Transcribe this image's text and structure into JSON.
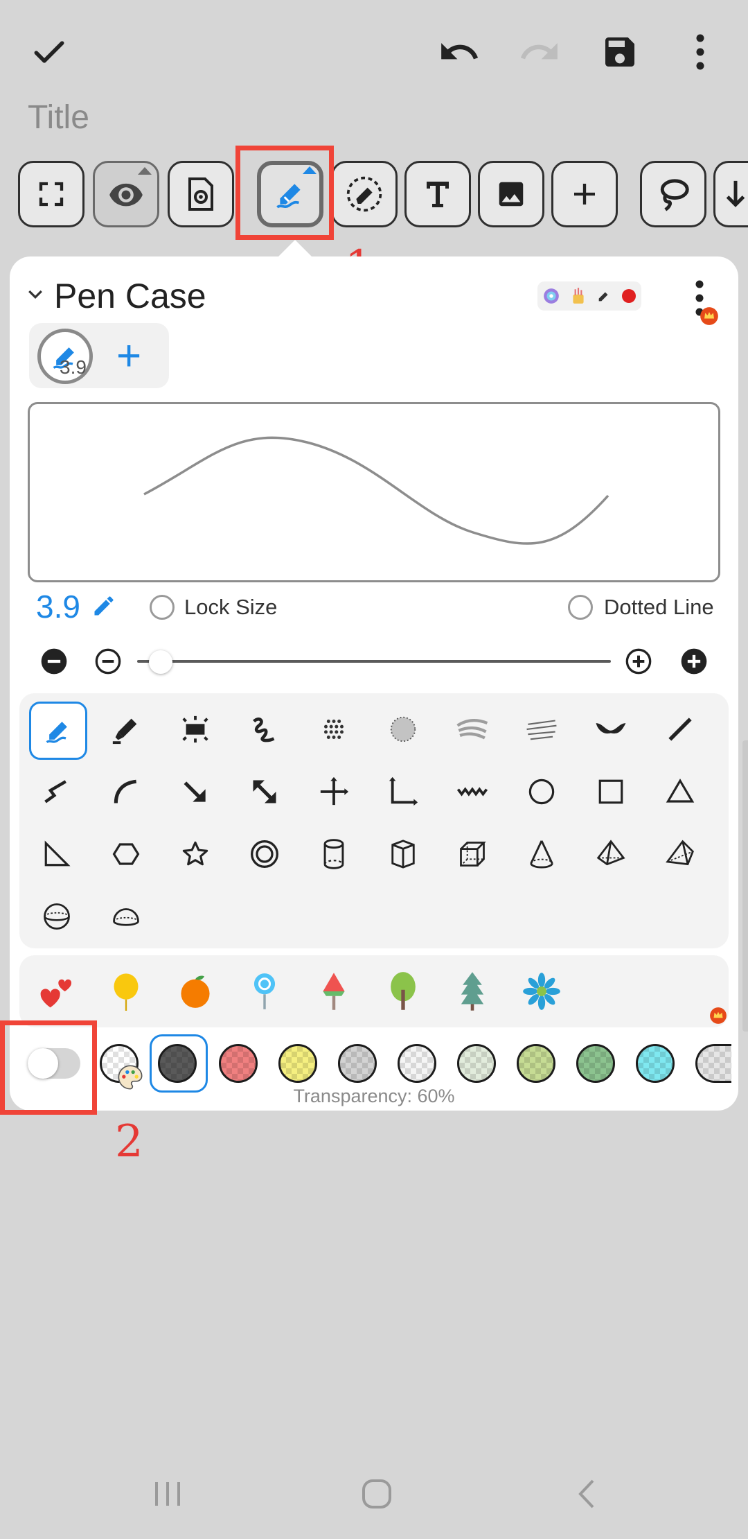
{
  "topbar": {
    "confirm_icon": "checkmark-icon",
    "undo_icon": "undo-icon",
    "redo_icon": "redo-icon",
    "save_icon": "save-icon",
    "more_icon": "more-vertical-icon",
    "title_placeholder": "Title"
  },
  "toolbar": {
    "tools": [
      "fullscreen-icon",
      "eye-icon",
      "settings-page-icon",
      "pen-icon",
      "eraser-icon",
      "text-icon",
      "image-icon",
      "add-icon",
      "lasso-icon",
      "scroll-icon"
    ],
    "selected_tool": "pen-icon"
  },
  "annotations": {
    "marker_1": "1",
    "marker_2": "2"
  },
  "pen_case": {
    "title": "Pen Case",
    "current_pen_size": "3.9",
    "add_label": "+",
    "size_value": "3.9",
    "lock_size_label": "Lock Size",
    "dotted_line_label": "Dotted Line",
    "size_slider_fraction": 0.03,
    "transparency_label": "Transparency: 60%",
    "accent_color": "#1e88e5",
    "highlight_color": "#f04438"
  },
  "pen_types": [
    "fountain-pen",
    "marker",
    "dashed-pen",
    "spiral-pen",
    "dotted-brush",
    "spray",
    "charcoal",
    "pencil-texture",
    "calligraphy-brush",
    "straight-line",
    "zigzag-line",
    "arc",
    "arrow",
    "double-arrow",
    "axis-cross",
    "axis-l",
    "wave-line",
    "circle",
    "square",
    "triangle",
    "right-triangle",
    "hexagon",
    "star",
    "double-circle",
    "cylinder",
    "prism",
    "cube",
    "cone",
    "pyramid",
    "tetrahedron",
    "sphere",
    "hemisphere"
  ],
  "stickers": [
    "hearts",
    "balloon",
    "orange",
    "lollipop",
    "popsicle",
    "tree",
    "pine-tree",
    "flower"
  ],
  "colors": [
    "#ffffff",
    "#5a5a5a",
    "#f08080",
    "#f5ef80",
    "#d3d3d3",
    "#f5f5f5",
    "#e2ecdc",
    "#c6dc94",
    "#8cc38f",
    "#7fe8f0",
    "#e6e6e6"
  ],
  "selected_color_index": 1
}
